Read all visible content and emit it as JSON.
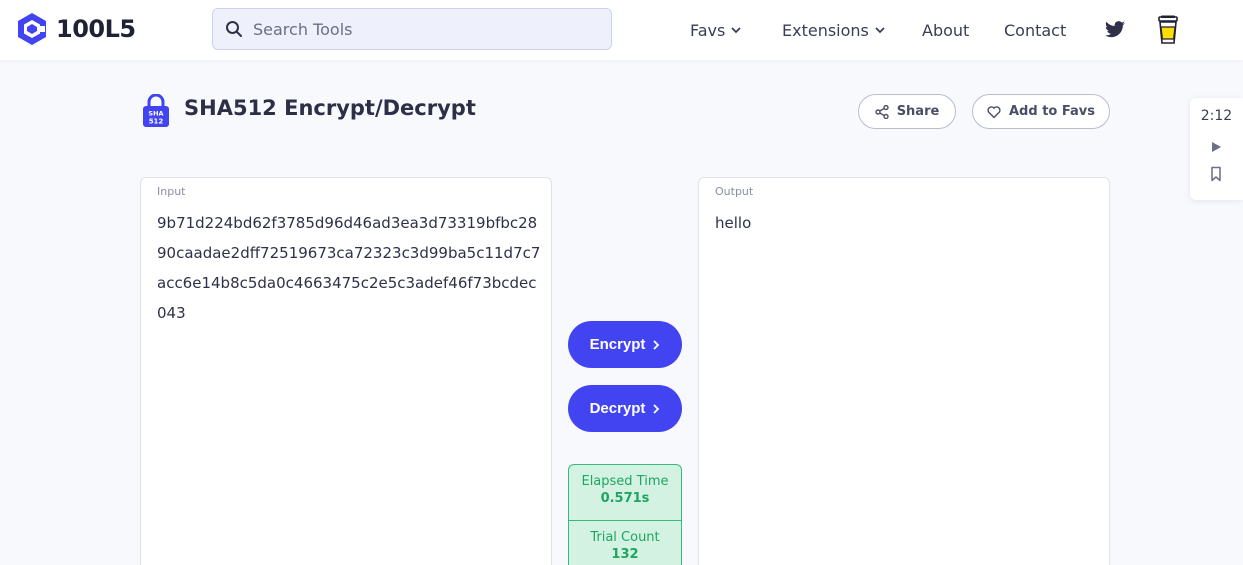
{
  "brand": {
    "name": "100L5"
  },
  "search": {
    "placeholder": "Search Tools"
  },
  "nav": {
    "favs": "Favs",
    "extensions": "Extensions",
    "about": "About",
    "contact": "Contact"
  },
  "tool": {
    "icon_label": "SHA\n512",
    "title": "SHA512 Encrypt/Decrypt",
    "share": "Share",
    "add_to_favs": "Add to Favs"
  },
  "side_widget": {
    "time": "2:12"
  },
  "input_panel": {
    "label": "Input",
    "value": "9b71d224bd62f3785d96d46ad3ea3d73319bfbc2890caadae2dff72519673ca72323c3d99ba5c11d7c7acc6e14b8c5da0c4663475c2e5c3adef46f73bcdec043"
  },
  "output_panel": {
    "label": "Output",
    "value": "hello"
  },
  "actions": {
    "encrypt": "Encrypt",
    "decrypt": "Decrypt"
  },
  "stats": {
    "elapsed_label": "Elapsed Time",
    "elapsed_value": "0.571s",
    "trial_label": "Trial Count",
    "trial_value": "132"
  },
  "colors": {
    "primary": "#4144f0",
    "success_bg": "#d3f2e2",
    "success_text": "#1fa562",
    "page_bg": "#f8f9fd"
  }
}
